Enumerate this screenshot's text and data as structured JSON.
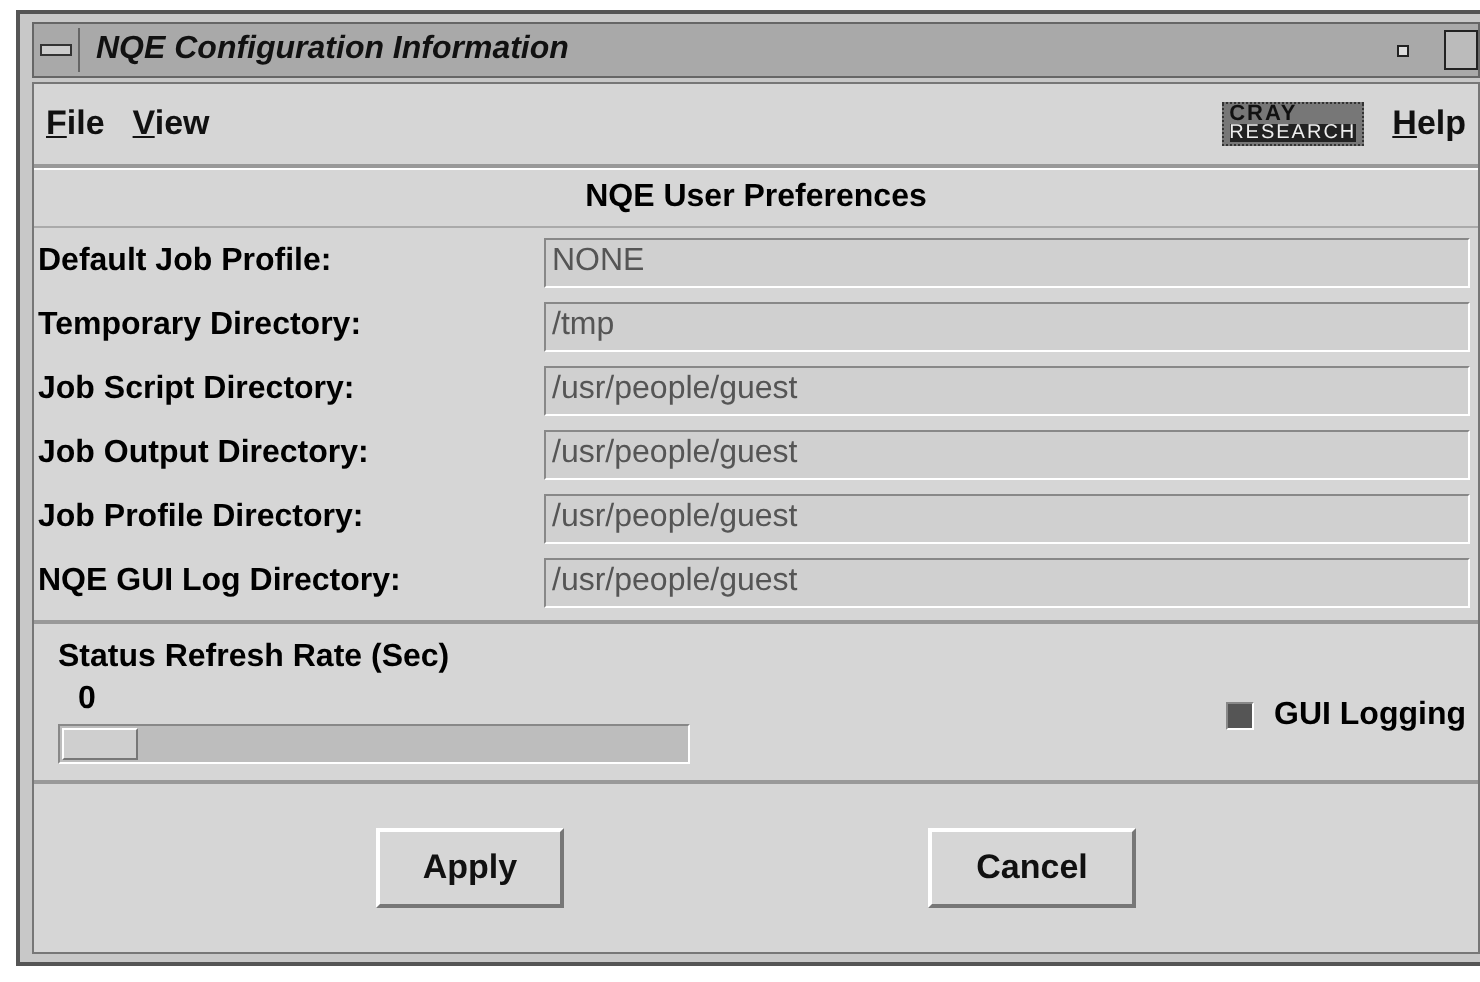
{
  "window": {
    "title": "NQE Configuration Information"
  },
  "menu": [
    {
      "label": "File"
    },
    {
      "label": "View"
    }
  ],
  "logo": {
    "top": "CRAY",
    "bottom": "RESEARCH"
  },
  "help_menu": {
    "label": "Help"
  },
  "section_title": "NQE User Preferences",
  "fields": [
    {
      "label": "Default Job Profile:",
      "value": "NONE"
    },
    {
      "label": "Temporary Directory:",
      "value": "/tmp"
    },
    {
      "label": "Job Script Directory:",
      "value": "/usr/people/guest"
    },
    {
      "label": "Job Output Directory:",
      "value": "/usr/people/guest"
    },
    {
      "label": "Job Profile Directory:",
      "value": "/usr/people/guest"
    },
    {
      "label": "NQE GUI Log Directory:",
      "value": "/usr/people/guest"
    }
  ],
  "refresh": {
    "label": "Status Refresh Rate (Sec)",
    "reading": "0",
    "level": 0
  },
  "gui_logging": {
    "label": "GUI Logging",
    "checked": true
  },
  "buttons": [
    {
      "label": "Apply"
    },
    {
      "label": "Cancel"
    }
  ]
}
